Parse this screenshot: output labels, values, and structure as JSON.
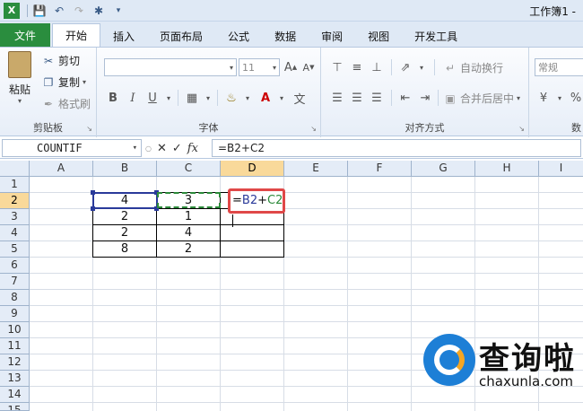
{
  "window": {
    "title": "工作簿1 -"
  },
  "tabs": [
    {
      "label": "文件"
    },
    {
      "label": "开始"
    },
    {
      "label": "插入"
    },
    {
      "label": "页面布局"
    },
    {
      "label": "公式"
    },
    {
      "label": "数据"
    },
    {
      "label": "审阅"
    },
    {
      "label": "视图"
    },
    {
      "label": "开发工具"
    }
  ],
  "ribbon": {
    "clipboard": {
      "label": "剪贴板",
      "paste": "粘贴",
      "cut": "剪切",
      "copy": "复制",
      "format_painter": "格式刷"
    },
    "font": {
      "label": "字体",
      "size": "11",
      "bold": "B",
      "italic": "I",
      "underline": "U"
    },
    "alignment": {
      "label": "对齐方式",
      "wrap": "自动换行",
      "merge": "合并后居中"
    },
    "number": {
      "label": "数",
      "format": "常规"
    }
  },
  "formula_bar": {
    "name_box": "COUNTIF",
    "fx": "fx",
    "formula": "=B2+C2"
  },
  "grid": {
    "columns": [
      "A",
      "B",
      "C",
      "D",
      "E",
      "F",
      "G",
      "H",
      "I"
    ],
    "rows": [
      "1",
      "2",
      "3",
      "4",
      "5",
      "6",
      "7",
      "8",
      "9",
      "10",
      "11",
      "12",
      "13",
      "14",
      "15"
    ],
    "cells": {
      "b2": "4",
      "c2": "3",
      "b3": "2",
      "c3": "1",
      "b4": "2",
      "c4": "4",
      "b5": "8",
      "c5": "2"
    },
    "editing": {
      "prefix": "=",
      "ref1": "B2",
      "op": "+",
      "ref2": "C2"
    }
  },
  "watermark": {
    "cn": "查询啦",
    "en": "chaxunla.com"
  },
  "colors": {
    "file_tab": "#2a8d3e",
    "selected_header": "#f9d99a",
    "edit_border": "#e04848",
    "ref_blue": "#2a3a9a",
    "ref_green": "#2c8a3a"
  }
}
